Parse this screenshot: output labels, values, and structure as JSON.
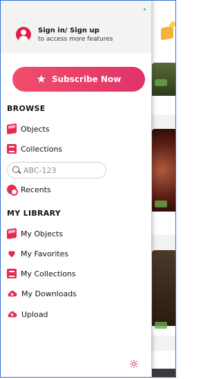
{
  "account": {
    "title": "Sign in/ Sign up",
    "subtitle": "to access more features"
  },
  "subscribe": {
    "label": "Subscribe Now"
  },
  "browse": {
    "heading": "BROWSE",
    "items": [
      {
        "label": "Objects",
        "icon": "cube-icon"
      },
      {
        "label": "Collections",
        "icon": "book-icon"
      }
    ],
    "search": {
      "placeholder": "ABC-123"
    },
    "recents": {
      "label": "Recents",
      "icon": "recents-icon"
    }
  },
  "library": {
    "heading": "MY LIBRARY",
    "items": [
      {
        "label": "My Objects",
        "icon": "cube-icon"
      },
      {
        "label": "My Favorites",
        "icon": "heart-icon"
      },
      {
        "label": "My Collections",
        "icon": "book-icon"
      },
      {
        "label": "My Downloads",
        "icon": "download-cloud-icon"
      },
      {
        "label": "Upload",
        "icon": "upload-cloud-icon"
      }
    ]
  },
  "colors": {
    "accent": "#e52b50",
    "subscribe_start": "#f04e6b",
    "subscribe_end": "#e0336a"
  }
}
